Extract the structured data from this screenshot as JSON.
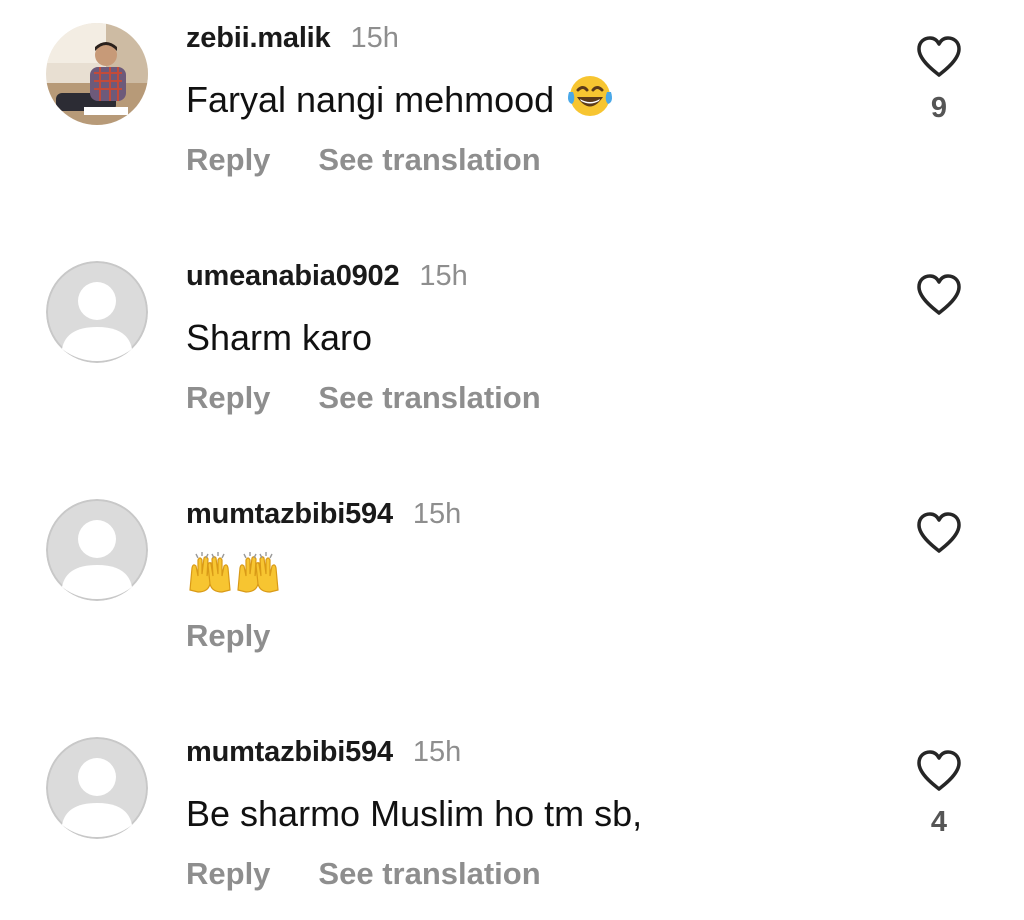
{
  "comments": [
    {
      "username": "zebii.malik",
      "time": "15h",
      "text": "Faryal nangi mehmood",
      "emoji": "face-with-tears-of-joy",
      "reply_label": "Reply",
      "translate_label": "See translation",
      "likes": "9"
    },
    {
      "username": "umeanabia0902",
      "time": "15h",
      "text": "Sharm karo",
      "reply_label": "Reply",
      "translate_label": "See translation"
    },
    {
      "username": "mumtazbibi594",
      "time": "15h",
      "emoji": "raising-hands x2",
      "reply_label": "Reply"
    },
    {
      "username": "mumtazbibi594",
      "time": "15h",
      "text": "Be sharmo Muslim ho tm sb,",
      "reply_label": "Reply",
      "translate_label": "See translation",
      "likes": "4"
    }
  ],
  "colors": {
    "username": "#1a1a1a",
    "meta": "#8e8e8e",
    "heart_outline": "#262626",
    "default_avatar_bg": "#dbdbdb"
  },
  "icons": {
    "like": "heart-outline-icon",
    "default_avatar": "default-avatar-icon"
  }
}
